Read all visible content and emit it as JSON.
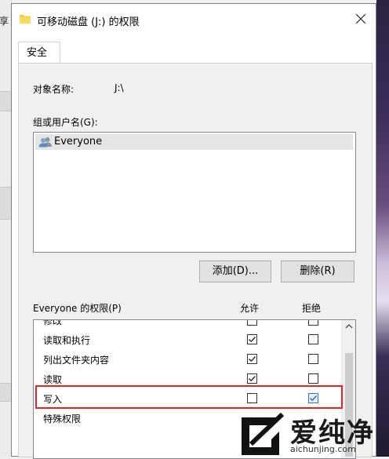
{
  "background": {
    "left_fragment_text": "享"
  },
  "window": {
    "title": "可移动磁盘 (J:) 的权限",
    "close_glyph": "✕"
  },
  "tabs": [
    {
      "label": "安全"
    }
  ],
  "object": {
    "label": "对象名称:",
    "value": "J:\\"
  },
  "groups": {
    "label": "组或用户名(G):",
    "items": [
      {
        "name": "Everyone",
        "icon": "users-icon"
      }
    ]
  },
  "buttons": {
    "add": "添加(D)...",
    "remove": "删除(R)"
  },
  "permissions": {
    "label": "Everyone 的权限(P)",
    "allow_header": "允许",
    "deny_header": "拒绝",
    "rows": [
      {
        "name": "修改",
        "allow": false,
        "deny": false
      },
      {
        "name": "读取和执行",
        "allow": true,
        "deny": false
      },
      {
        "name": "列出文件夹内容",
        "allow": true,
        "deny": false
      },
      {
        "name": "读取",
        "allow": true,
        "deny": false
      },
      {
        "name": "写入",
        "allow": false,
        "deny": true
      },
      {
        "name": "特殊权限",
        "allow": false,
        "deny": false
      }
    ]
  },
  "watermark": {
    "brand": "爱纯净",
    "url": "aichunjing.com"
  },
  "colors": {
    "highlight": "#e0262c",
    "deny_checked_border": "#3a74c9"
  }
}
